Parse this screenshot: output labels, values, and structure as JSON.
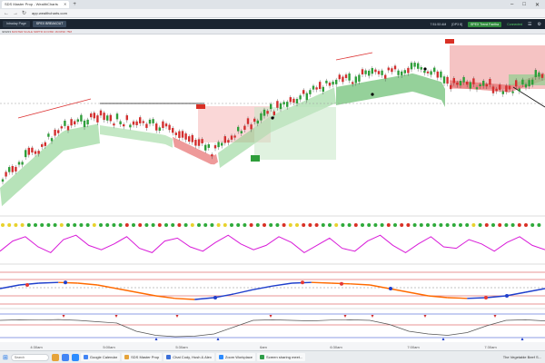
{
  "browser": {
    "tab_title": "SDS Master Prop - WealthCharts",
    "url": "app.wealthcharts.com",
    "new_tab": "+",
    "minimize": "–",
    "maximize": "□",
    "close": "✕"
  },
  "toolbar": {
    "tabs": [
      "Intraday Page",
      "SPEX BREAKOUT"
    ],
    "time": "7:51:53 AM",
    "latency": "[DP3 8]",
    "account": "SPEX Trend Fantha",
    "status": "Connected"
  },
  "chart_header": {
    "symbol": "/ESZ23",
    "indicator": "MASTER SCALE  SDPTR 1D  RISK 1M  RISK 75M"
  },
  "taskbar": {
    "search_placeholder": "Search",
    "apps": [
      {
        "label": "Google Calendar",
        "color": "#4285f4"
      },
      {
        "label": "SDS Master Prop",
        "color": "#e5a33a"
      },
      {
        "label": "Chat Cody, Hush & Alex",
        "color": "#3b6fd8"
      },
      {
        "label": "Zoom Workplace",
        "color": "#2d8cff"
      },
      {
        "label": "Screen sharing meet...",
        "color": "#2f9e4a"
      }
    ],
    "news": "The Vegetable Beef S..."
  },
  "chart_data": [
    {
      "type": "candlestick",
      "title": "",
      "x_tick_labels": [
        "4:30am",
        "5:00am",
        "5:30am",
        "6am",
        "6:30am",
        "7:00am",
        "7:30am"
      ],
      "zones": [
        {
          "name": "uptrend-channel-1",
          "color": "#3fae4a"
        },
        {
          "name": "downtrend-zone",
          "color": "#e25656"
        },
        {
          "name": "uptrend-channel-2",
          "color": "#3fae4a"
        },
        {
          "name": "downtrend-zone-2",
          "color": "#e25656"
        }
      ],
      "markers": [
        "BUY",
        "SELL"
      ]
    },
    {
      "type": "line",
      "title": "",
      "series": [
        {
          "values": [
            0.35,
            0.7,
            0.85,
            0.5,
            0.3,
            0.75,
            0.9,
            0.55,
            0.4,
            0.6,
            0.85,
            0.45,
            0.3,
            0.7,
            0.8,
            0.5,
            0.35,
            0.65,
            0.9,
            0.6,
            0.4,
            0.55,
            0.85,
            0.65,
            0.3,
            0.55,
            0.8,
            0.45,
            0.35,
            0.7,
            0.9,
            0.55,
            0.3,
            0.6,
            0.85,
            0.5,
            0.45,
            0.75,
            0.6,
            0.35,
            0.65,
            0.85,
            0.55,
            0.4
          ]
        }
      ]
    },
    {
      "type": "line",
      "title": "",
      "series": [
        {
          "values": [
            0.45,
            0.55,
            0.6,
            0.62,
            0.6,
            0.55,
            0.45,
            0.35,
            0.25,
            0.18,
            0.15,
            0.2,
            0.3,
            0.42,
            0.52,
            0.6,
            0.62,
            0.6,
            0.58,
            0.55,
            0.45,
            0.35,
            0.25,
            0.2,
            0.18,
            0.2,
            0.25,
            0.35,
            0.45
          ]
        }
      ]
    },
    {
      "type": "line",
      "title": "",
      "series": [
        {
          "values": [
            0.7,
            0.72,
            0.71,
            0.73,
            0.7,
            0.65,
            0.6,
            0.3,
            0.15,
            0.1,
            0.12,
            0.2,
            0.45,
            0.7,
            0.72,
            0.7,
            0.68,
            0.71,
            0.72,
            0.7,
            0.55,
            0.3,
            0.2,
            0.15,
            0.25,
            0.5,
            0.7,
            0.72,
            0.68
          ]
        }
      ]
    }
  ]
}
